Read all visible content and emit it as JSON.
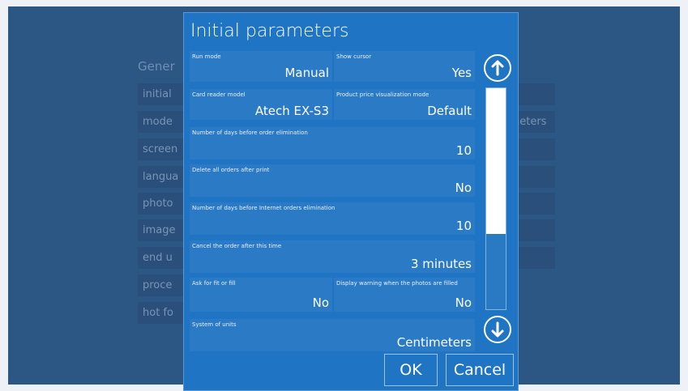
{
  "background": {
    "header": "Gener",
    "left_items": [
      "initial",
      "mode",
      "screen",
      "langua",
      "photo",
      "image",
      "end u",
      "proce",
      "hot fo"
    ],
    "right_items": [
      "s",
      "neters",
      "",
      "",
      "",
      "",
      "t"
    ]
  },
  "dialog": {
    "title": "Initial parameters",
    "params": {
      "run_mode": {
        "label": "Run mode",
        "value": "Manual"
      },
      "show_cursor": {
        "label": "Show cursor",
        "value": "Yes"
      },
      "card_reader": {
        "label": "Card reader model",
        "value": "Atech EX-S3"
      },
      "price_mode": {
        "label": "Product price visualization mode",
        "value": "Default"
      },
      "days_order": {
        "label": "Number of days before order elimination",
        "value": "10"
      },
      "delete_orders": {
        "label": "Delete all orders after print",
        "value": "No"
      },
      "days_internet": {
        "label": "Number of days before Internet orders elimination",
        "value": "10"
      },
      "cancel_after": {
        "label": "Cancel the order after this time",
        "value": "3 minutes"
      },
      "fit_fill": {
        "label": "Ask for fit or fill",
        "value": "No"
      },
      "warning_filled": {
        "label": "Display warning when the photos are filled",
        "value": "No"
      },
      "units": {
        "label": "System of units",
        "value": "Centimeters"
      }
    },
    "scroll": {
      "up_icon": "arrow-up-circle-icon",
      "down_icon": "arrow-down-circle-icon",
      "position": 0.0
    },
    "ok_label": "OK",
    "cancel_label": "Cancel"
  }
}
